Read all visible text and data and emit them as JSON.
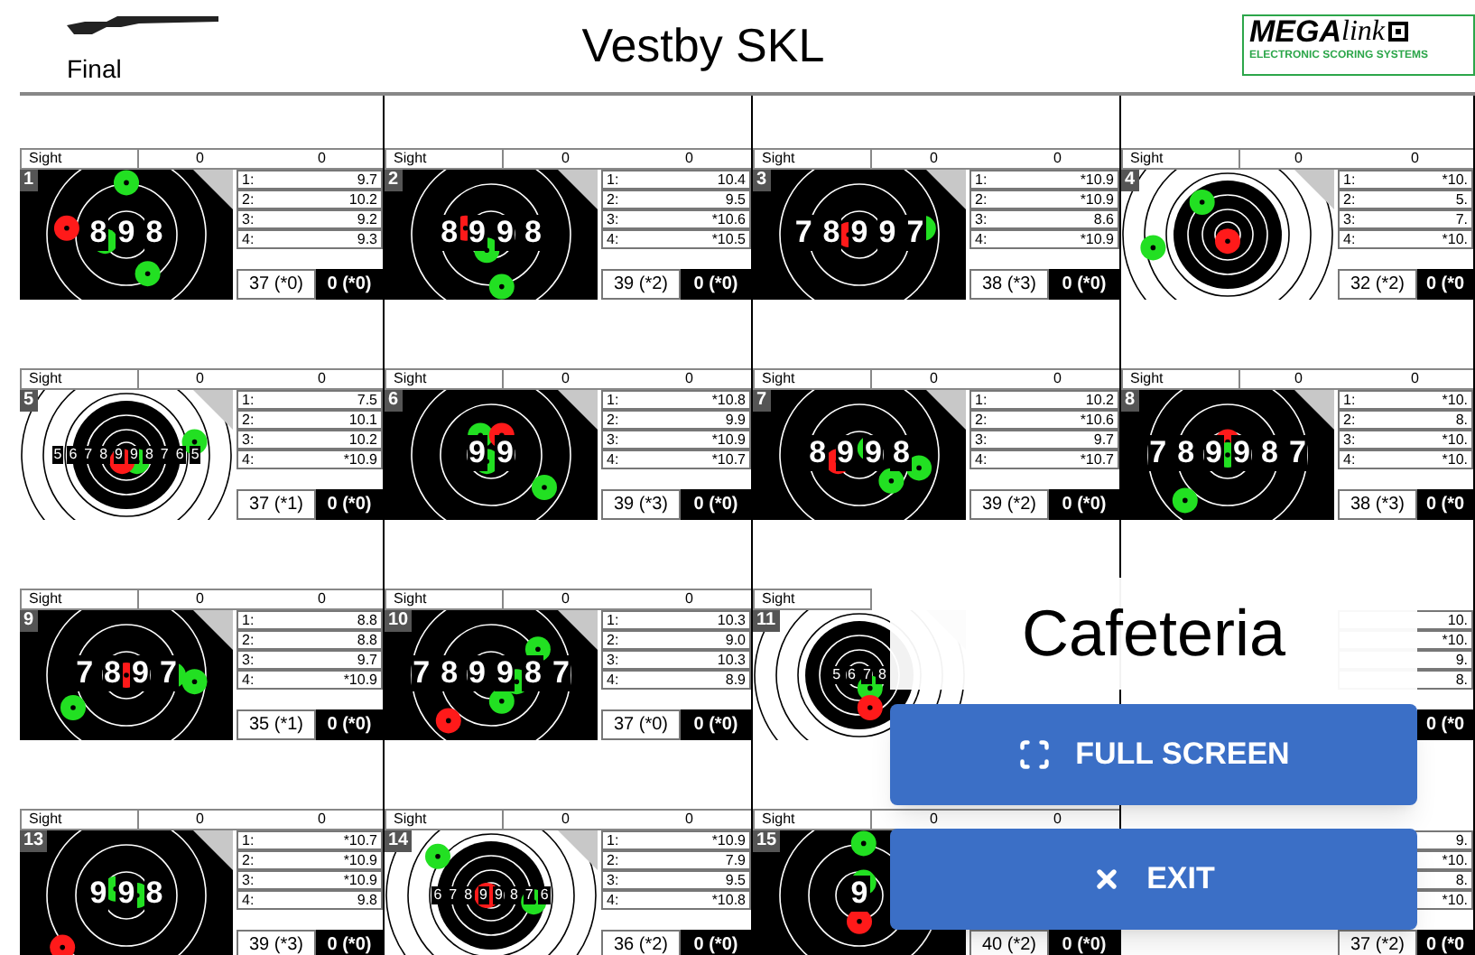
{
  "header": {
    "mode": "Final",
    "title": "Vestby SKL",
    "logo": {
      "brand": "MEGA",
      "brand_script": "link",
      "tagline": "ELECTRONIC SCORING SYSTEMS"
    }
  },
  "lanes": [
    {
      "number": "1",
      "sight_label": "Sight",
      "sight": [
        "0",
        "0"
      ],
      "target": {
        "kind": "close",
        "ring_labels": [
          "8",
          "9",
          "8"
        ]
      },
      "shots": [
        {
          "label": "1:",
          "value": "9.7"
        },
        {
          "label": "2:",
          "value": "10.2"
        },
        {
          "label": "3:",
          "value": "9.2"
        },
        {
          "label": "4:",
          "value": "9.3"
        }
      ],
      "total": "37 (*0)",
      "final": "0 (*0)"
    },
    {
      "number": "2",
      "sight_label": "Sight",
      "sight": [
        "0",
        "0"
      ],
      "target": {
        "kind": "close",
        "ring_labels": [
          "8",
          "9",
          "9",
          "8"
        ]
      },
      "shots": [
        {
          "label": "1:",
          "value": "10.4"
        },
        {
          "label": "2:",
          "value": "9.5"
        },
        {
          "label": "3:",
          "value": "*10.6"
        },
        {
          "label": "4:",
          "value": "*10.5"
        }
      ],
      "total": "39 (*2)",
      "final": "0 (*0)"
    },
    {
      "number": "3",
      "sight_label": "Sight",
      "sight": [
        "0",
        "0"
      ],
      "target": {
        "kind": "close",
        "ring_labels": [
          "7",
          "8",
          "9",
          "9",
          "7"
        ]
      },
      "shots": [
        {
          "label": "1:",
          "value": "*10.9"
        },
        {
          "label": "2:",
          "value": "*10.9"
        },
        {
          "label": "3:",
          "value": "8.6"
        },
        {
          "label": "4:",
          "value": "*10.9"
        }
      ],
      "total": "38 (*3)",
      "final": "0 (*0)"
    },
    {
      "number": "4",
      "sight_label": "Sight",
      "sight": [
        "0",
        "0"
      ],
      "target": {
        "kind": "wide"
      },
      "shots": [
        {
          "label": "1:",
          "value": "*10."
        },
        {
          "label": "2:",
          "value": "5."
        },
        {
          "label": "3:",
          "value": "7."
        },
        {
          "label": "4:",
          "value": "*10."
        }
      ],
      "total": "32 (*2)",
      "final": "0 (*0"
    },
    {
      "number": "5",
      "sight_label": "Sight",
      "sight": [
        "0",
        "0"
      ],
      "target": {
        "kind": "wide",
        "ring_labels": [
          "5",
          "6",
          "7",
          "8",
          "9",
          "9",
          "8",
          "7",
          "6",
          "5"
        ]
      },
      "shots": [
        {
          "label": "1:",
          "value": "7.5"
        },
        {
          "label": "2:",
          "value": "10.1"
        },
        {
          "label": "3:",
          "value": "10.2"
        },
        {
          "label": "4:",
          "value": "*10.9"
        }
      ],
      "total": "37 (*1)",
      "final": "0 (*0)"
    },
    {
      "number": "6",
      "sight_label": "Sight",
      "sight": [
        "0",
        "0"
      ],
      "target": {
        "kind": "close",
        "ring_labels": [
          "9",
          "9"
        ]
      },
      "shots": [
        {
          "label": "1:",
          "value": "*10.8"
        },
        {
          "label": "2:",
          "value": "9.9"
        },
        {
          "label": "3:",
          "value": "*10.9"
        },
        {
          "label": "4:",
          "value": "*10.7"
        }
      ],
      "total": "39 (*3)",
      "final": "0 (*0)"
    },
    {
      "number": "7",
      "sight_label": "Sight",
      "sight": [
        "0",
        "0"
      ],
      "target": {
        "kind": "close",
        "ring_labels": [
          "8",
          "9",
          "9",
          "8"
        ]
      },
      "shots": [
        {
          "label": "1:",
          "value": "10.2"
        },
        {
          "label": "2:",
          "value": "*10.6"
        },
        {
          "label": "3:",
          "value": "9.7"
        },
        {
          "label": "4:",
          "value": "*10.7"
        }
      ],
      "total": "39 (*2)",
      "final": "0 (*0)"
    },
    {
      "number": "8",
      "sight_label": "Sight",
      "sight": [
        "0",
        "0"
      ],
      "target": {
        "kind": "close",
        "ring_labels": [
          "7",
          "8",
          "9",
          "9",
          "8",
          "7"
        ]
      },
      "shots": [
        {
          "label": "1:",
          "value": "*10."
        },
        {
          "label": "2:",
          "value": "8."
        },
        {
          "label": "3:",
          "value": "*10."
        },
        {
          "label": "4:",
          "value": "*10."
        }
      ],
      "total": "38 (*3)",
      "final": "0 (*0"
    },
    {
      "number": "9",
      "sight_label": "Sight",
      "sight": [
        "0",
        "0"
      ],
      "target": {
        "kind": "close",
        "ring_labels": [
          "7",
          "8",
          "9",
          "7"
        ]
      },
      "shots": [
        {
          "label": "1:",
          "value": "8.8"
        },
        {
          "label": "2:",
          "value": "8.8"
        },
        {
          "label": "3:",
          "value": "9.7"
        },
        {
          "label": "4:",
          "value": "*10.9"
        }
      ],
      "total": "35 (*1)",
      "final": "0 (*0)"
    },
    {
      "number": "10",
      "sight_label": "Sight",
      "sight": [
        "0",
        "0"
      ],
      "target": {
        "kind": "close",
        "ring_labels": [
          "7",
          "8",
          "9",
          "9",
          "8",
          "7"
        ]
      },
      "shots": [
        {
          "label": "1:",
          "value": "10.3"
        },
        {
          "label": "2:",
          "value": "9.0"
        },
        {
          "label": "3:",
          "value": "10.3"
        },
        {
          "label": "4:",
          "value": "8.9"
        }
      ],
      "total": "37 (*0)",
      "final": "0 (*0)"
    },
    {
      "number": "11",
      "sight_label": "Sight",
      "target": {
        "kind": "wide",
        "ring_labels": [
          "5",
          "6",
          "7",
          "8"
        ]
      }
    },
    {
      "target": {
        "kind": "hidden"
      },
      "shots": [
        {
          "value": "10."
        },
        {
          "value": "*10."
        },
        {
          "value": "9."
        },
        {
          "value": "8."
        }
      ],
      "final": "0 (*0"
    },
    {
      "number": "13",
      "sight_label": "Sight",
      "sight": [
        "0",
        "0"
      ],
      "target": {
        "kind": "close",
        "ring_labels": [
          "9",
          "9",
          "8"
        ]
      },
      "shots": [
        {
          "label": "1:",
          "value": "*10.7"
        },
        {
          "label": "2:",
          "value": "*10.9"
        },
        {
          "label": "3:",
          "value": "*10.9"
        },
        {
          "label": "4:",
          "value": "9.8"
        }
      ],
      "total": "39 (*3)",
      "final": "0 (*0)"
    },
    {
      "number": "14",
      "sight_label": "Sight",
      "sight": [
        "0",
        "0"
      ],
      "target": {
        "kind": "wide",
        "ring_labels": [
          "6",
          "7",
          "8",
          "9",
          "9",
          "8",
          "7",
          "6"
        ]
      },
      "shots": [
        {
          "label": "1:",
          "value": "*10.9"
        },
        {
          "label": "2:",
          "value": "7.9"
        },
        {
          "label": "3:",
          "value": "9.5"
        },
        {
          "label": "4:",
          "value": "*10.8"
        }
      ],
      "total": "36 (*2)",
      "final": "0 (*0)"
    },
    {
      "number": "15",
      "sight_label": "Sight",
      "sight": [
        "0",
        "0"
      ],
      "target": {
        "kind": "close",
        "ring_labels": [
          "9"
        ]
      },
      "total": "40 (*2)",
      "final": "0 (*0)"
    },
    {
      "target": {
        "kind": "hidden"
      },
      "shots": [
        {
          "value": "9."
        },
        {
          "value": "*10."
        },
        {
          "value": "8."
        },
        {
          "value": "*10."
        }
      ],
      "total": "37 (*2)",
      "final": "0 (*0"
    }
  ],
  "overlay": {
    "location": "Cafeteria",
    "buttons": [
      {
        "kind": "fullscreen",
        "label": "FULL SCREEN"
      },
      {
        "kind": "exit",
        "label": "EXIT"
      }
    ]
  }
}
